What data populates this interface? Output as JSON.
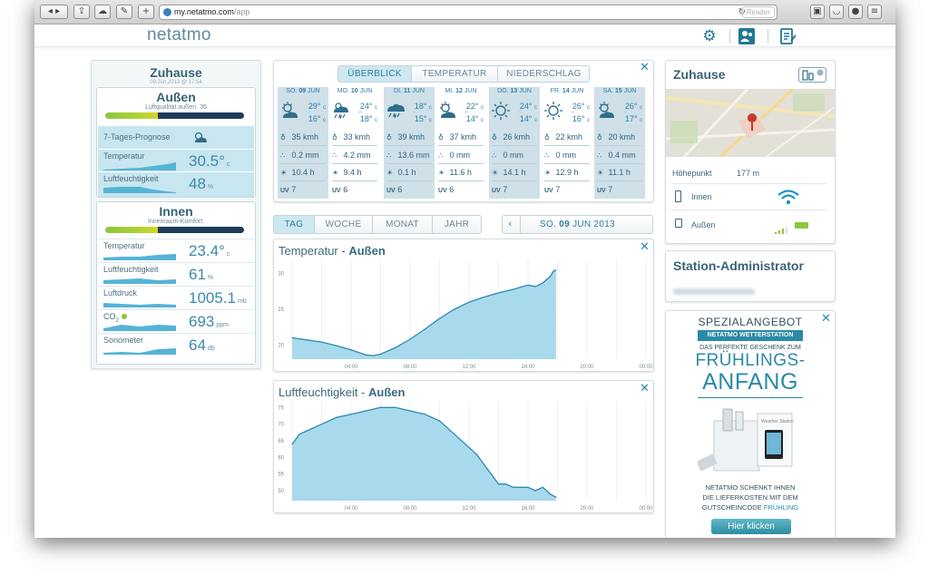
{
  "browser": {
    "url_host": "my.netatmo.com",
    "url_path": "/app",
    "reader_label": "Reader",
    "reload_icon": "reload-icon"
  },
  "app": {
    "logo": "netatmo"
  },
  "left": {
    "station_name": "Zuhause",
    "station_date": "09.Jun.2013 @ 17:54",
    "outdoor": {
      "title": "Außen",
      "quality_text": "Luftqualität außen. 35",
      "quality_value": 35,
      "forecast_label": "7-Tages-Prognose",
      "temp_label": "Temperatur",
      "temp_value": "30.5°",
      "temp_unit": "c",
      "hum_label": "Luftfeuchtigkeit",
      "hum_value": "48",
      "hum_unit": "%"
    },
    "indoor": {
      "title": "Innen",
      "comfort_text": "Innenraum-Komfort.",
      "temp_label": "Temperatur",
      "temp_value": "23.4°",
      "temp_unit": "c",
      "hum_label": "Luftfeuchtigkeit",
      "hum_value": "61",
      "hum_unit": "%",
      "press_label": "Luftdruck",
      "press_value": "1005.1",
      "press_unit": "mb",
      "co2_label": "CO",
      "co2_sub": "2",
      "co2_value": "693",
      "co2_unit": "ppm",
      "noise_label": "Sonometer",
      "noise_value": "64",
      "noise_unit": "db"
    }
  },
  "forecast": {
    "tabs": [
      "ÜBERBLICK",
      "TEMPERATUR",
      "NIEDERSCHLAG"
    ],
    "active_tab": 0,
    "days": [
      {
        "name": "SO.",
        "num": "09",
        "mon": "JUN",
        "icon": "partly-cloudy-icon",
        "hi": "29°",
        "lo": "16°",
        "unit": "c",
        "wind": "35 kmh",
        "rain": "0.2 mm",
        "sun": "10.4 h",
        "uv": "7"
      },
      {
        "name": "MO.",
        "num": "10",
        "mon": "JUN",
        "icon": "thunderstorm-icon",
        "hi": "24°",
        "lo": "18°",
        "unit": "c",
        "wind": "33 kmh",
        "rain": "4.2 mm",
        "sun": "9.4 h",
        "uv": "6"
      },
      {
        "name": "DI.",
        "num": "11",
        "mon": "JUN",
        "icon": "heavy-thunderstorm-icon",
        "hi": "18°",
        "lo": "15°",
        "unit": "c",
        "wind": "39 kmh",
        "rain": "13.6 mm",
        "sun": "0.1 h",
        "uv": "6"
      },
      {
        "name": "MI.",
        "num": "12",
        "mon": "JUN",
        "icon": "partly-cloudy-icon",
        "hi": "22°",
        "lo": "14°",
        "unit": "c",
        "wind": "37 kmh",
        "rain": "0 mm",
        "sun": "11.6 h",
        "uv": "6"
      },
      {
        "name": "DO.",
        "num": "13",
        "mon": "JUN",
        "icon": "sun-icon",
        "hi": "24°",
        "lo": "14°",
        "unit": "c",
        "wind": "26 kmh",
        "rain": "0 mm",
        "sun": "14.1 h",
        "uv": "7"
      },
      {
        "name": "FR.",
        "num": "14",
        "mon": "JUN",
        "icon": "sun-icon",
        "hi": "26°",
        "lo": "16°",
        "unit": "c",
        "wind": "22 kmh",
        "rain": "0 mm",
        "sun": "12.9 h",
        "uv": "7"
      },
      {
        "name": "SA.",
        "num": "15",
        "mon": "JUN",
        "icon": "partly-cloudy-icon",
        "hi": "26°",
        "lo": "17°",
        "unit": "c",
        "wind": "20 kmh",
        "rain": "0.4 mm",
        "sun": "11.1 h",
        "uv": "7"
      }
    ],
    "uv_label": "UV"
  },
  "range_tabs": [
    "TAG",
    "WOCHE",
    "MONAT",
    "JAHR"
  ],
  "active_range": 0,
  "date_nav": {
    "prefix": "SO.",
    "day": "09",
    "rest": "JUN 2013"
  },
  "charts": {
    "temperature": {
      "title": "Temperatur - ",
      "location": "Außen",
      "type": "area",
      "x_labels": [
        "04:00",
        "08:00",
        "12:00",
        "16:00",
        "20:00",
        "00:00"
      ],
      "x_range": [
        0,
        24
      ],
      "ylim": [
        18,
        32
      ],
      "y_ticks": [
        20,
        25,
        30
      ],
      "x": [
        0,
        1,
        2,
        3,
        4,
        5,
        5.5,
        6,
        7,
        8,
        9,
        10,
        11,
        12,
        13,
        14,
        15,
        16,
        16.5,
        17,
        17.5,
        17.75,
        17.9
      ],
      "y": [
        21.0,
        20.7,
        20.4,
        19.9,
        19.3,
        18.6,
        18.5,
        18.7,
        19.6,
        20.8,
        22.2,
        23.7,
        25.0,
        26.0,
        26.7,
        27.3,
        27.8,
        28.4,
        28.2,
        28.7,
        29.6,
        30.4,
        30.5
      ]
    },
    "humidity": {
      "title": "Luftfeuchtigkeit - ",
      "location": "Außen",
      "type": "area",
      "x_labels": [
        "04:00",
        "08:00",
        "12:00",
        "16:00",
        "20:00",
        "00:00"
      ],
      "x_range": [
        0,
        24
      ],
      "ylim": [
        47,
        77
      ],
      "y_ticks": [
        50,
        55,
        60,
        65,
        70,
        75
      ],
      "x": [
        0,
        0.5,
        1,
        2,
        3,
        4,
        5,
        6,
        7,
        8,
        9,
        10,
        11,
        12,
        12.5,
        13,
        13.5,
        14,
        14.5,
        15,
        16,
        16.5,
        17,
        17.5,
        17.9
      ],
      "y": [
        64,
        67,
        68,
        70,
        72,
        73,
        74,
        75,
        75,
        74,
        73,
        71,
        67,
        63,
        61,
        58,
        55,
        52,
        52,
        51,
        51,
        50,
        51,
        49,
        48
      ]
    }
  },
  "right": {
    "station_title": "Zuhause",
    "altitude_label": "Höhepunkt",
    "altitude_value": "177 m",
    "module_indoor": "Innen",
    "module_outdoor": "Außen",
    "admin_title": "Station-Administrator",
    "ad": {
      "line1": "SPEZIALANGEBOT",
      "line2": "NETATMO WETTERSTATION",
      "line3": "DAS PERFEKTE GESCHENK ZUM",
      "line4": "FRÜHLINGS-",
      "line5": "ANFANG",
      "body1": "NETATMO SCHENKT IHNEN",
      "body2": "DIE LIEFERKOSTEN MIT DEM",
      "body3": "GUTSCHEINCODE ",
      "code": "FRÜHLING",
      "button": "Hier klicken"
    }
  },
  "colors": {
    "accent": "#2f7ea1",
    "chart_fill": "#a9d9ec",
    "chart_line": "#2b8ab2"
  }
}
